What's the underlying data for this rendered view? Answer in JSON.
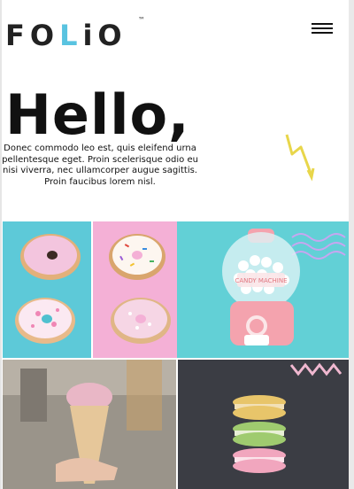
{
  "header": {
    "logo": {
      "pre": "FO",
      "accent": "L",
      "post": "iO",
      "tm": "™"
    },
    "menu_icon": "hamburger-icon"
  },
  "hero": {
    "title": "Hello,",
    "body": "Donec commodo leo est, quis eleifend urna pellentesque eget. Proin scelerisque odio eu nisi viverra, nec ullamcorper augue sagittis. Proin faucibus lorem nisl.",
    "decoration_icon": "lightning-bolt-icon"
  },
  "gallery": {
    "images": [
      {
        "name": "pink-donut-on-teal",
        "bg": "#5dc9d8"
      },
      {
        "name": "sprinkle-donuts-on-pink",
        "bg": "#f4b0d6"
      },
      {
        "name": "candy-machine",
        "label": "CANDY MACHINE",
        "bg": "#62d0d6"
      },
      {
        "name": "ice-cream-cone",
        "bg": "#8b857c"
      },
      {
        "name": "macaron-stack",
        "bg": "#3b3d44"
      }
    ]
  },
  "colors": {
    "accent": "#59c3e0",
    "bolt": "#e8d64a",
    "text": "#111111"
  }
}
